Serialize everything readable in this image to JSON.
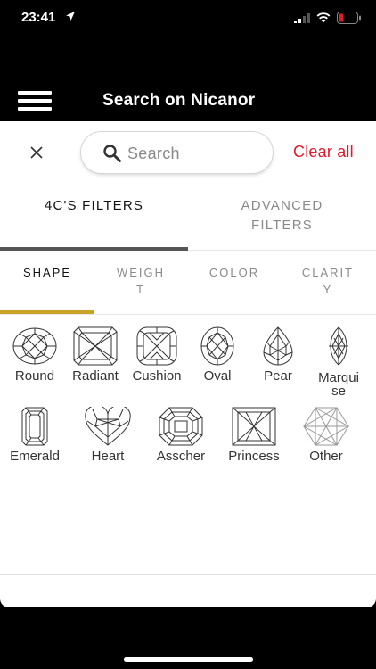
{
  "status_bar": {
    "time": "23:41"
  },
  "header": {
    "title": "Search on Nicanor"
  },
  "search": {
    "placeholder": "Search",
    "clear_all_label": "Clear all"
  },
  "main_tabs": [
    {
      "label": "4C'S FILTERS",
      "active": true
    },
    {
      "label": "ADVANCED FILTERS",
      "active": false
    }
  ],
  "sub_tabs": [
    {
      "label": "SHAPE",
      "active": true
    },
    {
      "label": "WEIGHT",
      "active": false
    },
    {
      "label": "COLOR",
      "active": false
    },
    {
      "label": "CLARITY",
      "active": false
    }
  ],
  "shapes": [
    {
      "label": "Round",
      "icon": "round-diamond-icon"
    },
    {
      "label": "Radiant",
      "icon": "radiant-diamond-icon"
    },
    {
      "label": "Cushion",
      "icon": "cushion-diamond-icon"
    },
    {
      "label": "Oval",
      "icon": "oval-diamond-icon"
    },
    {
      "label": "Pear",
      "icon": "pear-diamond-icon"
    },
    {
      "label": "Marquise",
      "icon": "marquise-diamond-icon"
    },
    {
      "label": "Emerald",
      "icon": "emerald-diamond-icon"
    },
    {
      "label": "Heart",
      "icon": "heart-diamond-icon"
    },
    {
      "label": "Asscher",
      "icon": "asscher-diamond-icon"
    },
    {
      "label": "Princess",
      "icon": "princess-diamond-icon"
    },
    {
      "label": "Other",
      "icon": "other-shape-icon"
    }
  ],
  "colors": {
    "accent_gold": "#c9a227",
    "clear_all_red": "#e0192b",
    "header_bg": "#000000"
  }
}
